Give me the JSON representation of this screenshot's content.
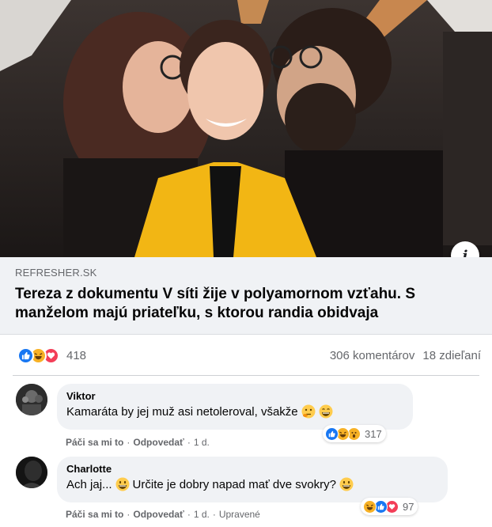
{
  "link": {
    "domain": "REFRESHER.SK",
    "title": "Tereza z dokumentu V síti žije v polyamornom vzťahu. S manželom majú priateľku, s ktorou randia obidvaja",
    "info_icon": "info-icon"
  },
  "reactions": {
    "types": [
      "like",
      "haha",
      "love"
    ],
    "count": "418",
    "comments": "306 komentárov",
    "shares": "18 zdieľaní"
  },
  "comments": [
    {
      "author": "Viktor",
      "text": "Kamaráta by jej muž asi netoleroval, všakže",
      "emojis": [
        "thinking-face",
        "grinning-face"
      ],
      "reaction_types": [
        "like",
        "haha",
        "wow"
      ],
      "reaction_count": "317",
      "like_label": "Páči sa mi to",
      "reply_label": "Odpovedať",
      "time": "1 d.",
      "edited": ""
    },
    {
      "author": "Charlotte",
      "text_before": "Ach jaj...",
      "text_after": "Určite je dobry napad mať dve svokry?",
      "emojis": [
        "grinning-face",
        "grinning-face"
      ],
      "reaction_types": [
        "haha",
        "like",
        "love"
      ],
      "reaction_count": "97",
      "like_label": "Páči sa mi to",
      "reply_label": "Odpovedať",
      "time": "1 d.",
      "edited": "Upravené"
    }
  ],
  "colors": {
    "like": "#1877f2",
    "love": "#f33e58",
    "haha": "#f7b125",
    "text_secondary": "#65676b"
  }
}
